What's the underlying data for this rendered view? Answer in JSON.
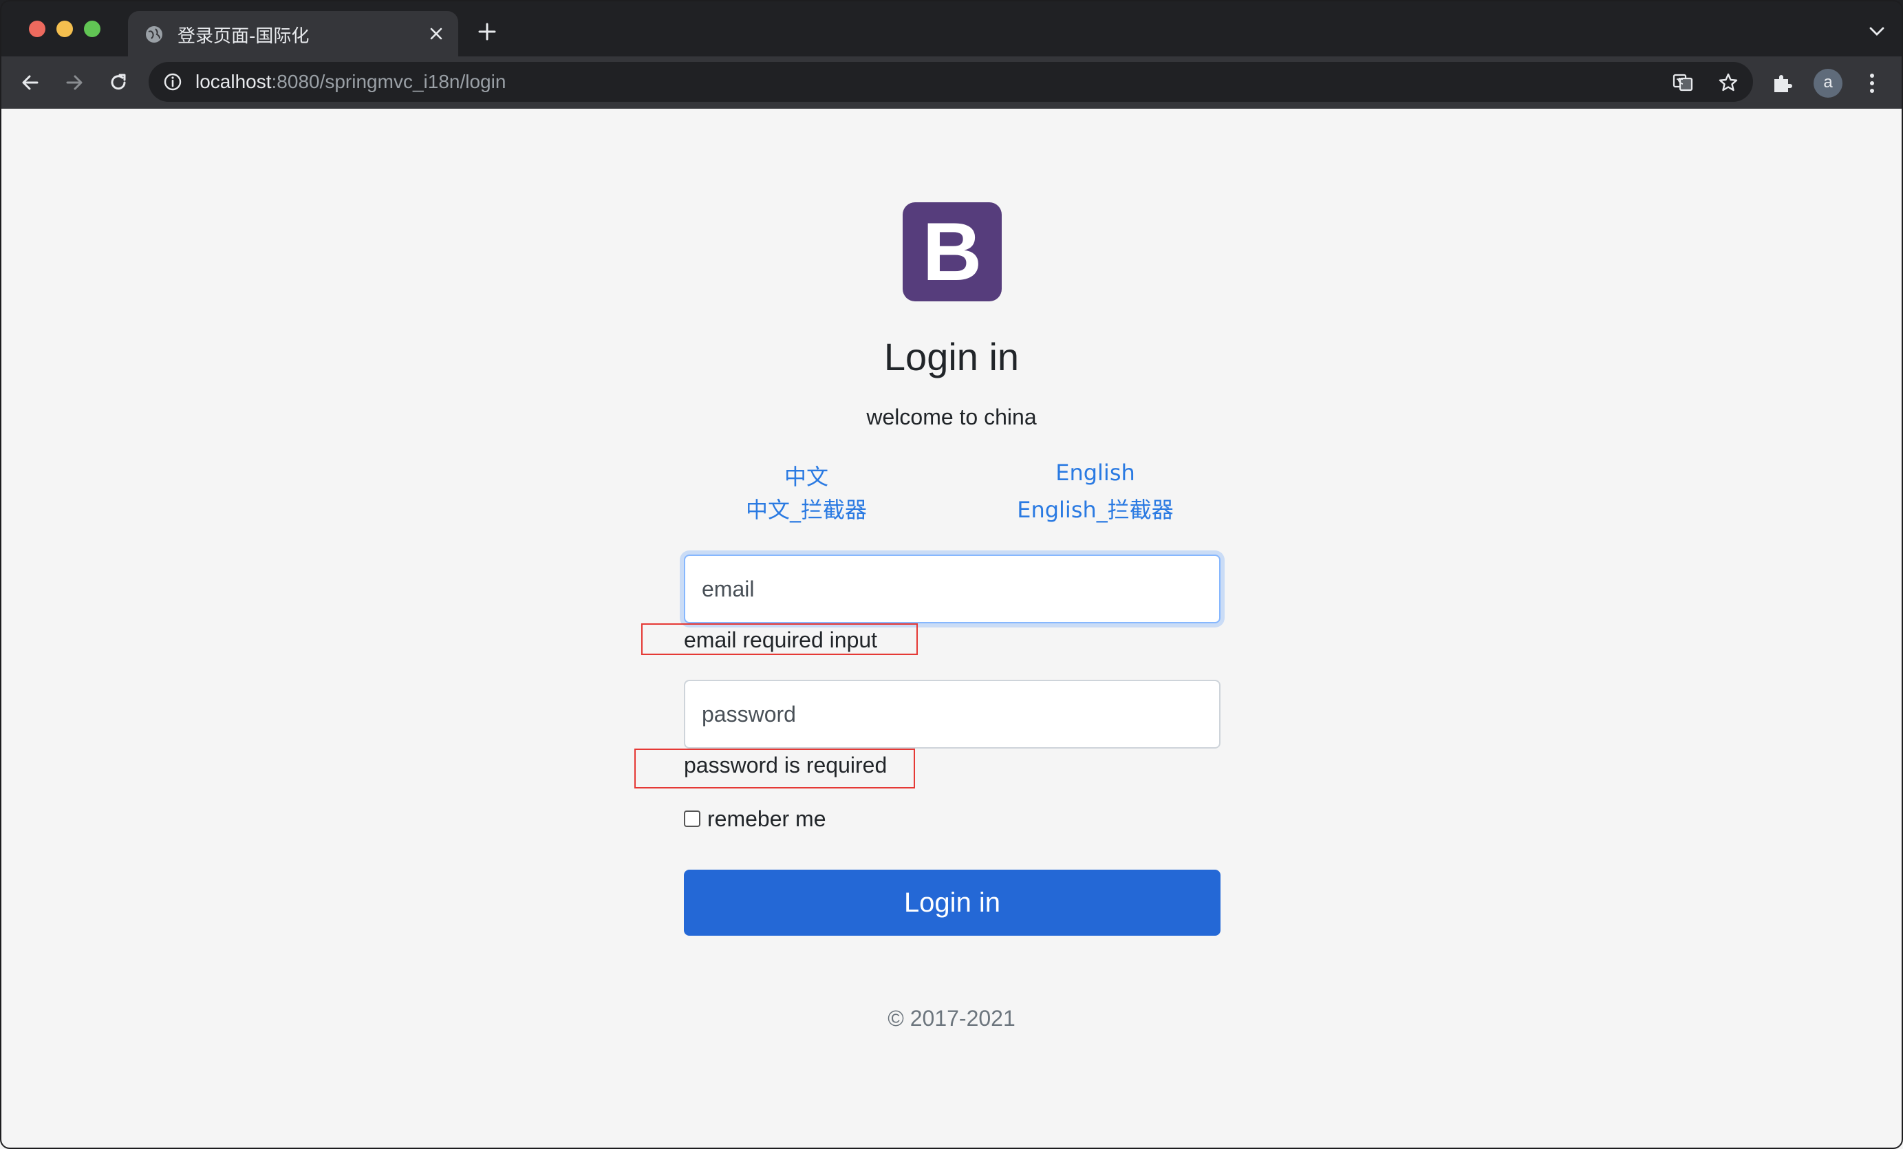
{
  "browser": {
    "tab_title": "登录页面-国际化",
    "url_host": "localhost",
    "url_rest": ":8080/springmvc_i18n/login",
    "avatar_letter": "a",
    "icons": [
      "globe-icon",
      "close-icon",
      "plus-icon",
      "chevron-down-icon",
      "back-arrow-icon",
      "forward-arrow-icon",
      "reload-icon",
      "info-icon",
      "translate-icon",
      "star-icon",
      "puzzle-icon",
      "kebab-menu-icon"
    ]
  },
  "page": {
    "logo_letter": "B",
    "logo_color": "#563d7c",
    "heading": "Login in",
    "welcome": "welcome to china",
    "lang_links": {
      "zh": "中文",
      "zh_interceptor": "中文_拦截器",
      "en": "English",
      "en_interceptor": "English_拦截器"
    },
    "link_color": "#2a7ae2",
    "form": {
      "email_placeholder": "email",
      "email_value": "",
      "email_error": "email required input",
      "password_placeholder": "password",
      "password_value": "",
      "password_error": "password is required",
      "remember_label": "remeber me",
      "remember_checked": false,
      "submit_label": "Login in",
      "submit_color": "#2468d6"
    },
    "copyright": "© 2017-2021"
  }
}
